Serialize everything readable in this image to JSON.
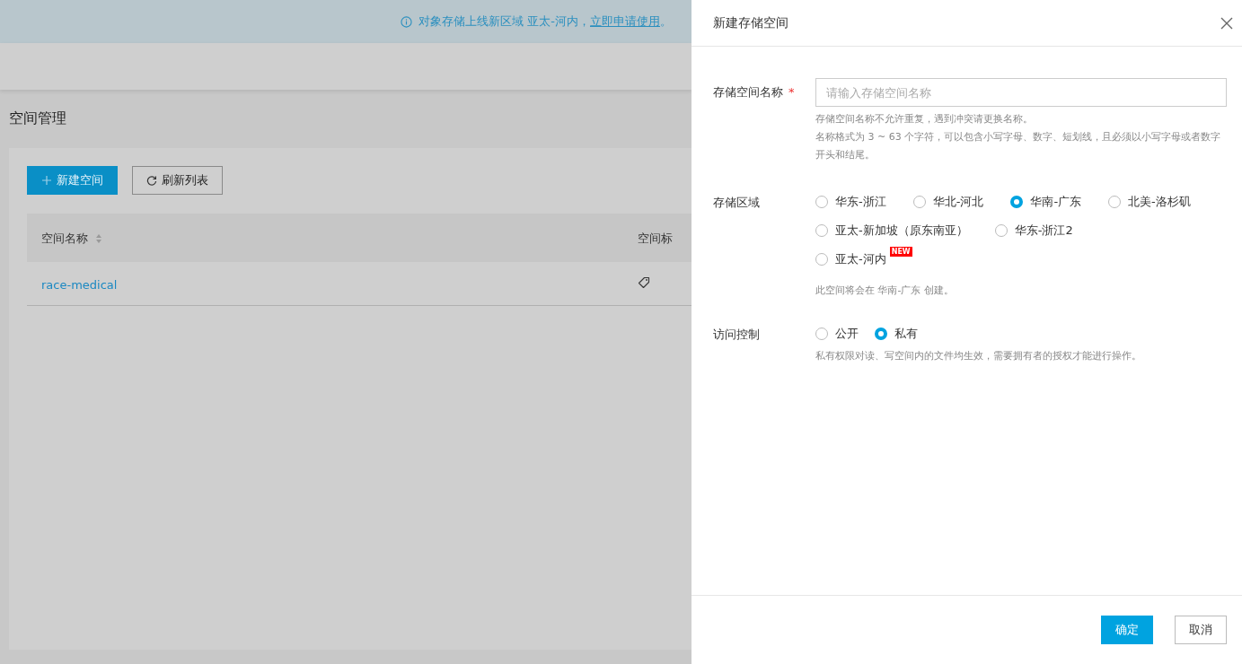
{
  "banner": {
    "text": "对象存储上线新区域 亚太-河内，",
    "link": "立即申请使用",
    "suffix": "。"
  },
  "page": {
    "title": "空间管理"
  },
  "toolbar": {
    "buttons": [
      {
        "label": "新建空间",
        "kind": "primary"
      },
      {
        "label": "刷新列表",
        "kind": "default"
      }
    ]
  },
  "table": {
    "columns": [
      {
        "label": "空间名称",
        "sortable": true
      },
      {
        "label": "空间标",
        "sortable": false
      }
    ],
    "rows": [
      {
        "name": "race-medical"
      }
    ]
  },
  "drawer": {
    "title": "新建存储空间",
    "name_field": {
      "label": "存储空间名称",
      "required": true,
      "required_mark": "*",
      "placeholder": "请输入存储空间名称",
      "help": [
        "存储空间名称不允许重复，遇到冲突请更换名称。",
        "名称格式为 3 ~ 63 个字符，可以包含小写字母、数字、短划线，且必须以小写字母或者数字开头和结尾。"
      ]
    },
    "region": {
      "label": "存储区域",
      "options": [
        {
          "label": "华东-浙江",
          "selected": false
        },
        {
          "label": "华北-河北",
          "selected": false
        },
        {
          "label": "华南-广东",
          "selected": true
        },
        {
          "label": "北美-洛杉矶",
          "selected": false
        },
        {
          "label": "亚太-新加坡（原东南亚）",
          "selected": false
        },
        {
          "label": "华东-浙江2",
          "selected": false
        },
        {
          "label": "亚太-河内",
          "selected": false,
          "badge": "NEW"
        }
      ],
      "help": "此空间将会在 华南-广东 创建。"
    },
    "access": {
      "label": "访问控制",
      "options": [
        {
          "label": "公开",
          "selected": false
        },
        {
          "label": "私有",
          "selected": true
        }
      ],
      "help": "私有权限对读、写空间内的文件均生效，需要拥有者的授权才能进行操作。"
    },
    "buttons": [
      {
        "label": "确定",
        "kind": "primary"
      },
      {
        "label": "取消",
        "kind": "default"
      }
    ]
  }
}
